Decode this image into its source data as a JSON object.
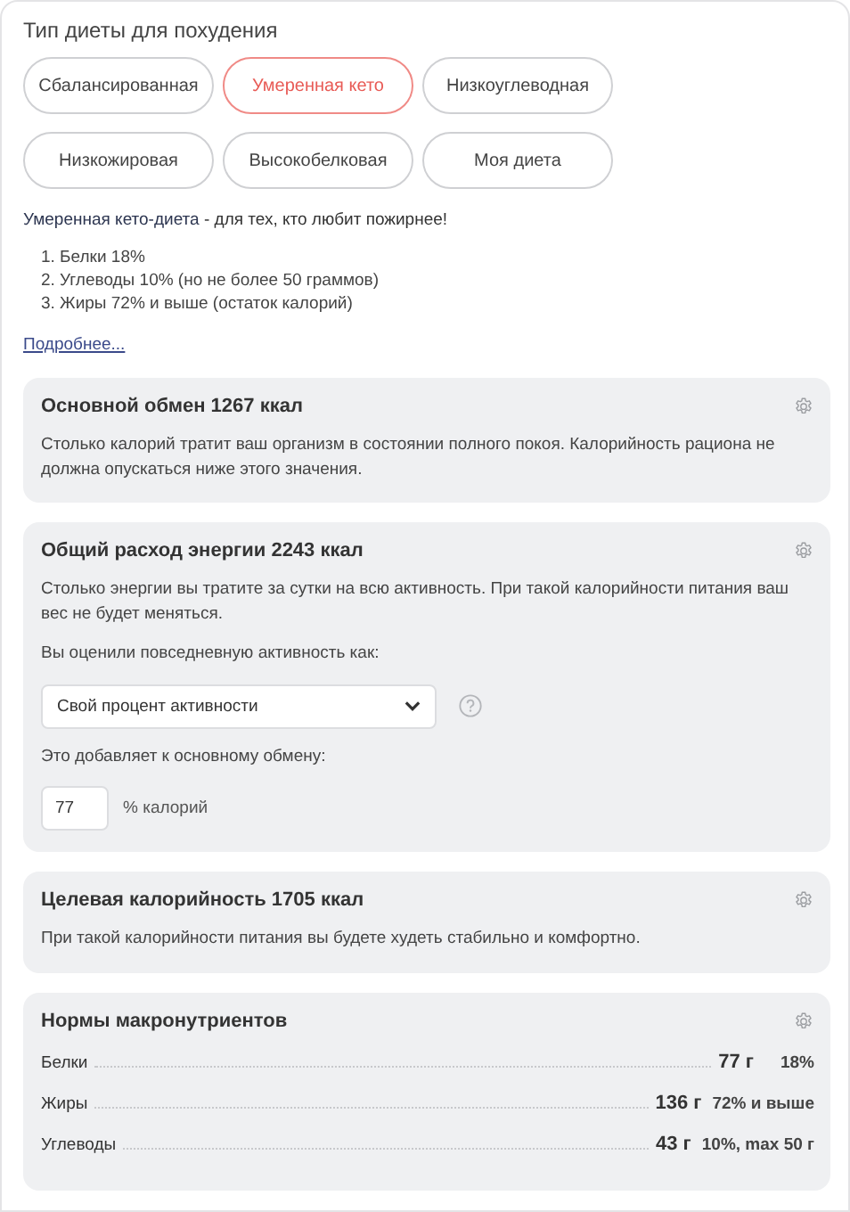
{
  "diet_type": {
    "title": "Тип диеты для похудения",
    "options": [
      {
        "label": "Сбалансированная",
        "selected": false
      },
      {
        "label": "Умеренная кето",
        "selected": true
      },
      {
        "label": "Низкоуглеводная",
        "selected": false
      },
      {
        "label": "Низкожировая",
        "selected": false
      },
      {
        "label": "Высокобелковая",
        "selected": false
      },
      {
        "label": "Моя диета",
        "selected": false
      }
    ],
    "description": "**Умеренная кето-диета** - для тех, кто любит пожирнее!",
    "list": [
      "1. Белки 18%",
      "2. Углеводы 10% (но не более 50 граммов)",
      "3. Жиры 72% и выше (остаток калорий)"
    ],
    "more_link": "Подробнее..."
  },
  "cards": [
    {
      "kind": "info",
      "title": "Основной обмен 1267 ккал",
      "text": "Столько калорий тратит ваш организм в состоянии полного покоя. Калорийность рациона не должна опускаться ниже этого значения."
    },
    {
      "kind": "activity",
      "title": "Общий расход энергии 2243 ккал",
      "text": "Столько энергии вы тратите за сутки на всю активность. При такой калорийности питания ваш вес не будет меняться.",
      "activity_label": "Вы оценили повседневную активность как:",
      "activity_select": "Свой процент активности",
      "adds_label": "Это добавляет к основному обмену:",
      "percent_value": "77",
      "percent_unit": "% калорий"
    },
    {
      "kind": "info",
      "title": "Целевая калорийность 1705 ккал",
      "text": "При такой калорийности питания вы будете худеть стабильно и комфортно."
    },
    {
      "kind": "macros",
      "title": "Нормы макронутриентов",
      "rows": [
        {
          "name": "Белки",
          "amount": "77 г",
          "share": "18%"
        },
        {
          "name": "Жиры",
          "amount": "136 г",
          "share": "72% и выше"
        },
        {
          "name": "Углеводы",
          "amount": "43 г",
          "share": "10%, max 50 г"
        }
      ]
    }
  ]
}
